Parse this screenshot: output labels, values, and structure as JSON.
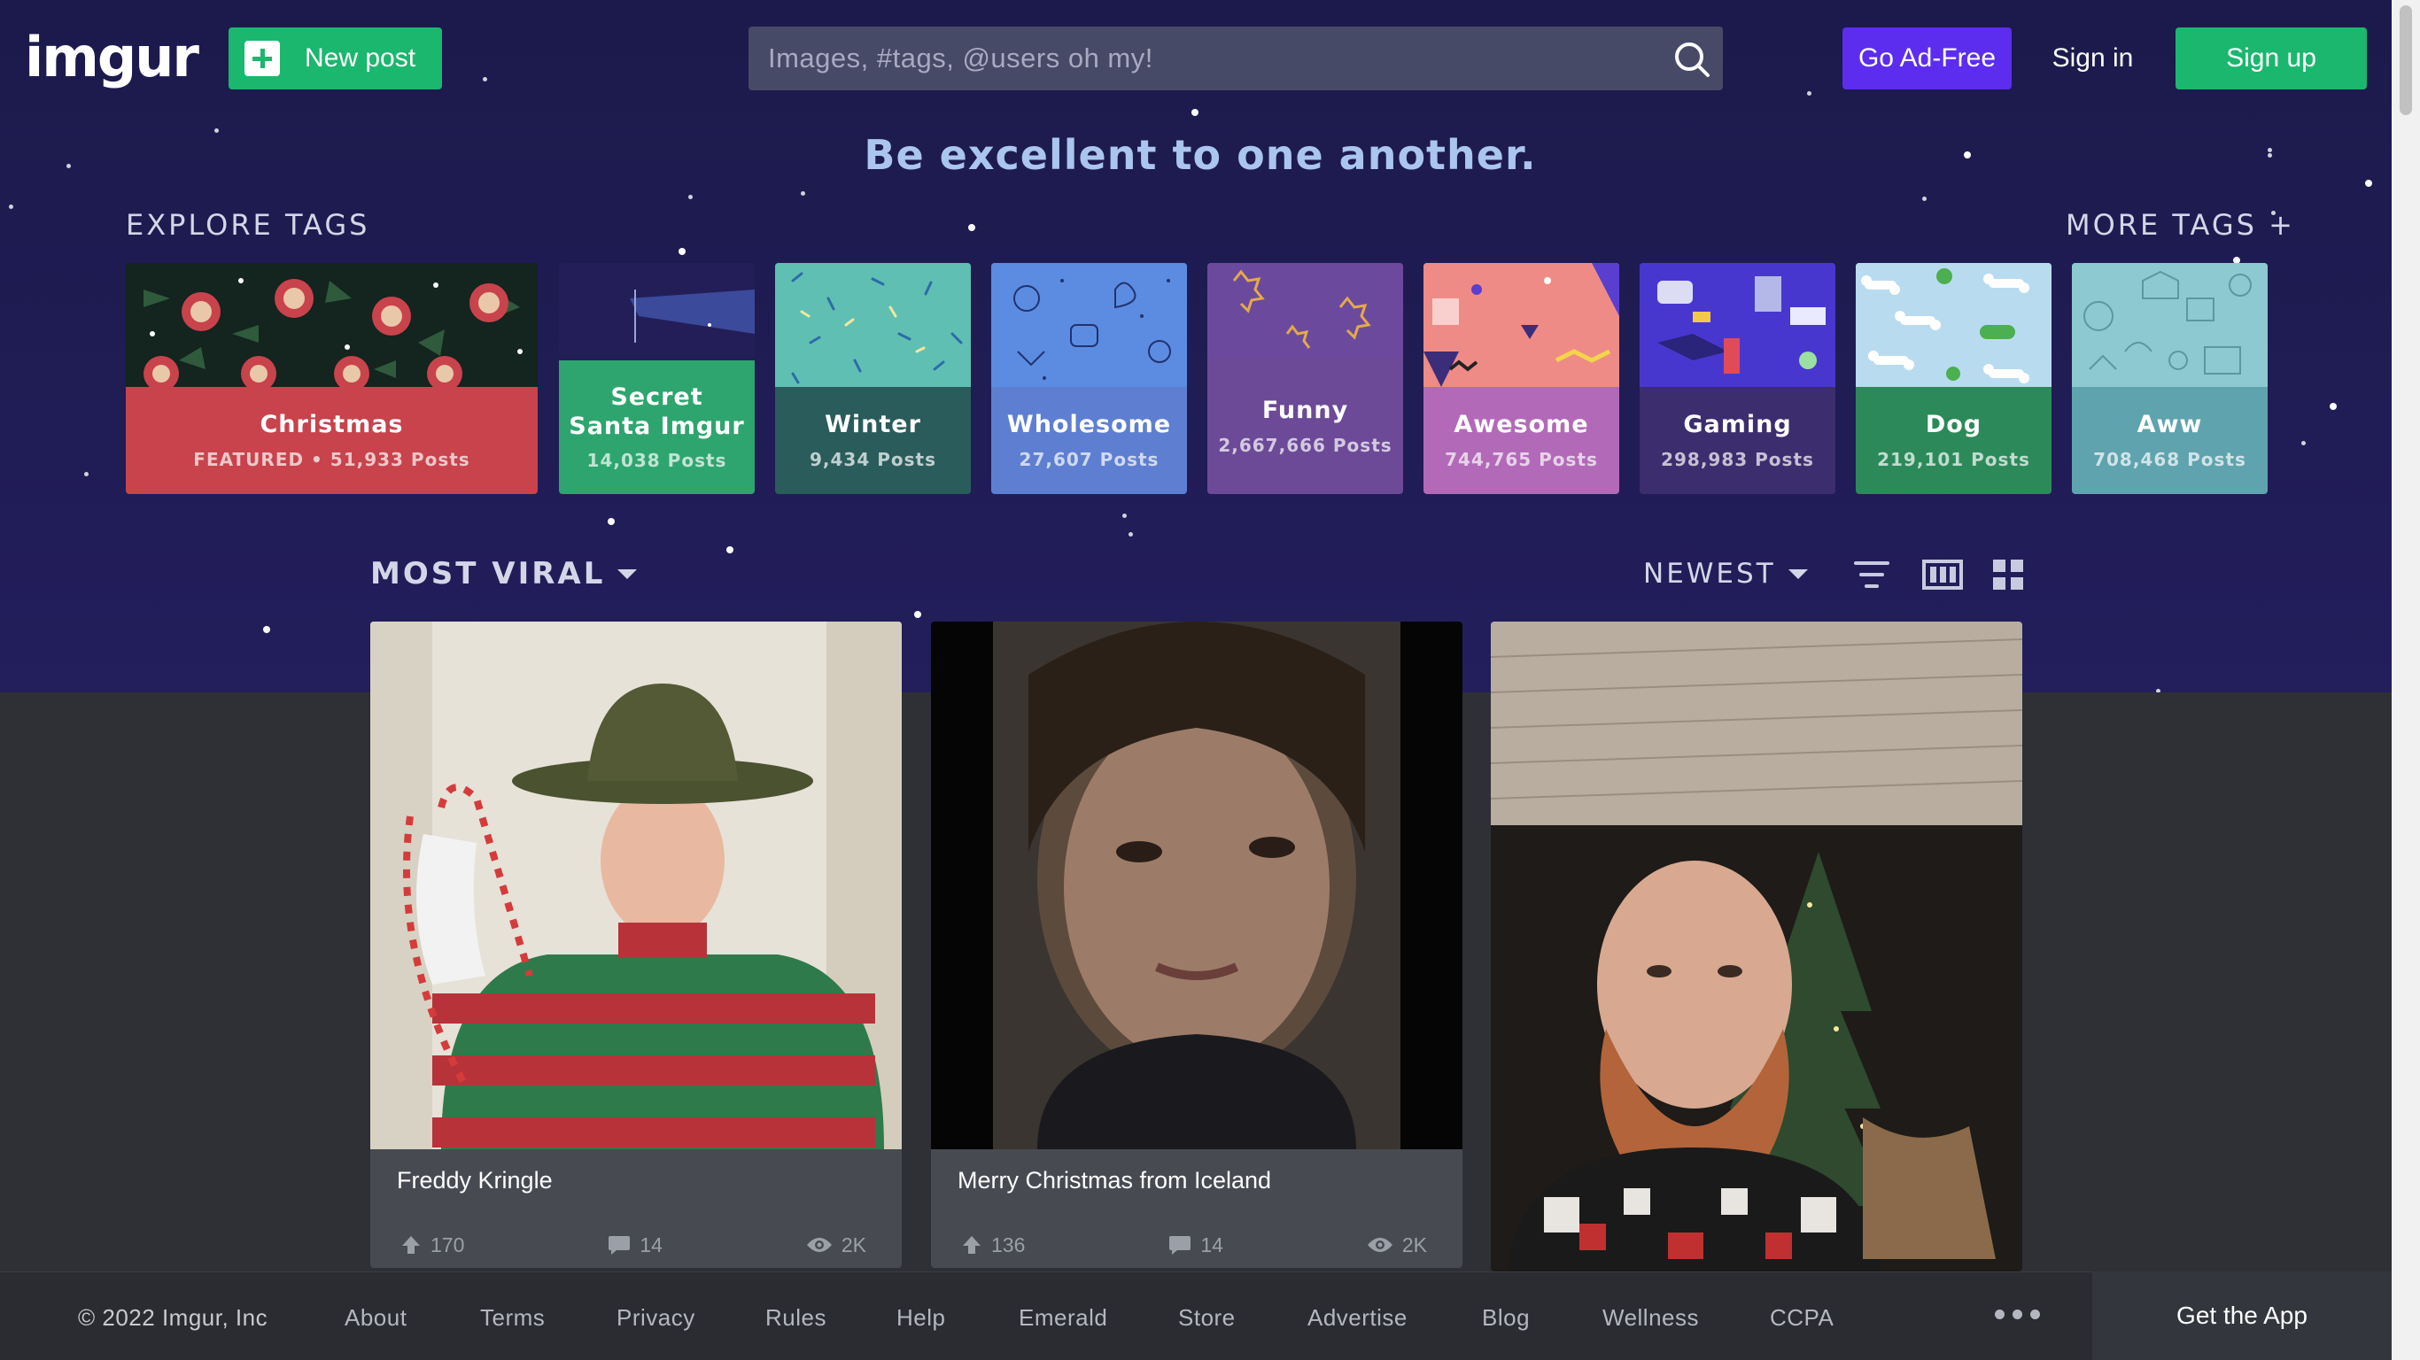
{
  "header": {
    "logo": "imgur",
    "new_post_label": "New post",
    "search_placeholder": "Images, #tags, @users oh my!",
    "ad_free_label": "Go Ad-Free",
    "sign_in_label": "Sign in",
    "sign_up_label": "Sign up"
  },
  "tagline": "Be excellent to one another.",
  "explore": {
    "title": "EXPLORE TAGS",
    "more_label": "MORE TAGS +",
    "tags": [
      {
        "name": "Christmas",
        "posts": "FEATURED • 51,933 Posts",
        "color": "#c8434c"
      },
      {
        "name": "Secret Santa Imgur",
        "posts": "14,038 Posts",
        "color": "#2ea56f"
      },
      {
        "name": "Winter",
        "posts": "9,434 Posts",
        "color": "#2a5c5c"
      },
      {
        "name": "Wholesome",
        "posts": "27,607 Posts",
        "color": "#5e7fd1"
      },
      {
        "name": "Funny",
        "posts": "2,667,666 Posts",
        "color": "#6c4a97"
      },
      {
        "name": "Awesome",
        "posts": "744,765 Posts",
        "color": "#b26ab8"
      },
      {
        "name": "Gaming",
        "posts": "298,983 Posts",
        "color": "#3c2d6e"
      },
      {
        "name": "Dog",
        "posts": "219,101 Posts",
        "color": "#2c8a5a"
      },
      {
        "name": "Aww",
        "posts": "708,468 Posts",
        "color": "#5fa3ae"
      }
    ]
  },
  "sort": {
    "section_label": "MOST VIRAL",
    "order_label": "NEWEST"
  },
  "posts": [
    {
      "title": "Freddy Kringle",
      "upvotes": "170",
      "comments": "14",
      "views": "2K"
    },
    {
      "title": "Merry Christmas from Iceland",
      "upvotes": "136",
      "comments": "14",
      "views": "2K"
    },
    {
      "title": "",
      "upvotes": "",
      "comments": "",
      "views": ""
    }
  ],
  "footer": {
    "copyright": "© 2022 Imgur, Inc",
    "links": [
      "About",
      "Terms",
      "Privacy",
      "Rules",
      "Help",
      "Emerald",
      "Store",
      "Advertise",
      "Blog",
      "Wellness",
      "CCPA"
    ],
    "get_app": "Get the App"
  },
  "colors": {
    "brand_green": "#1bb76e",
    "ad_free_purple": "#5c2dee",
    "hero_bg": "#1c1a4c"
  }
}
